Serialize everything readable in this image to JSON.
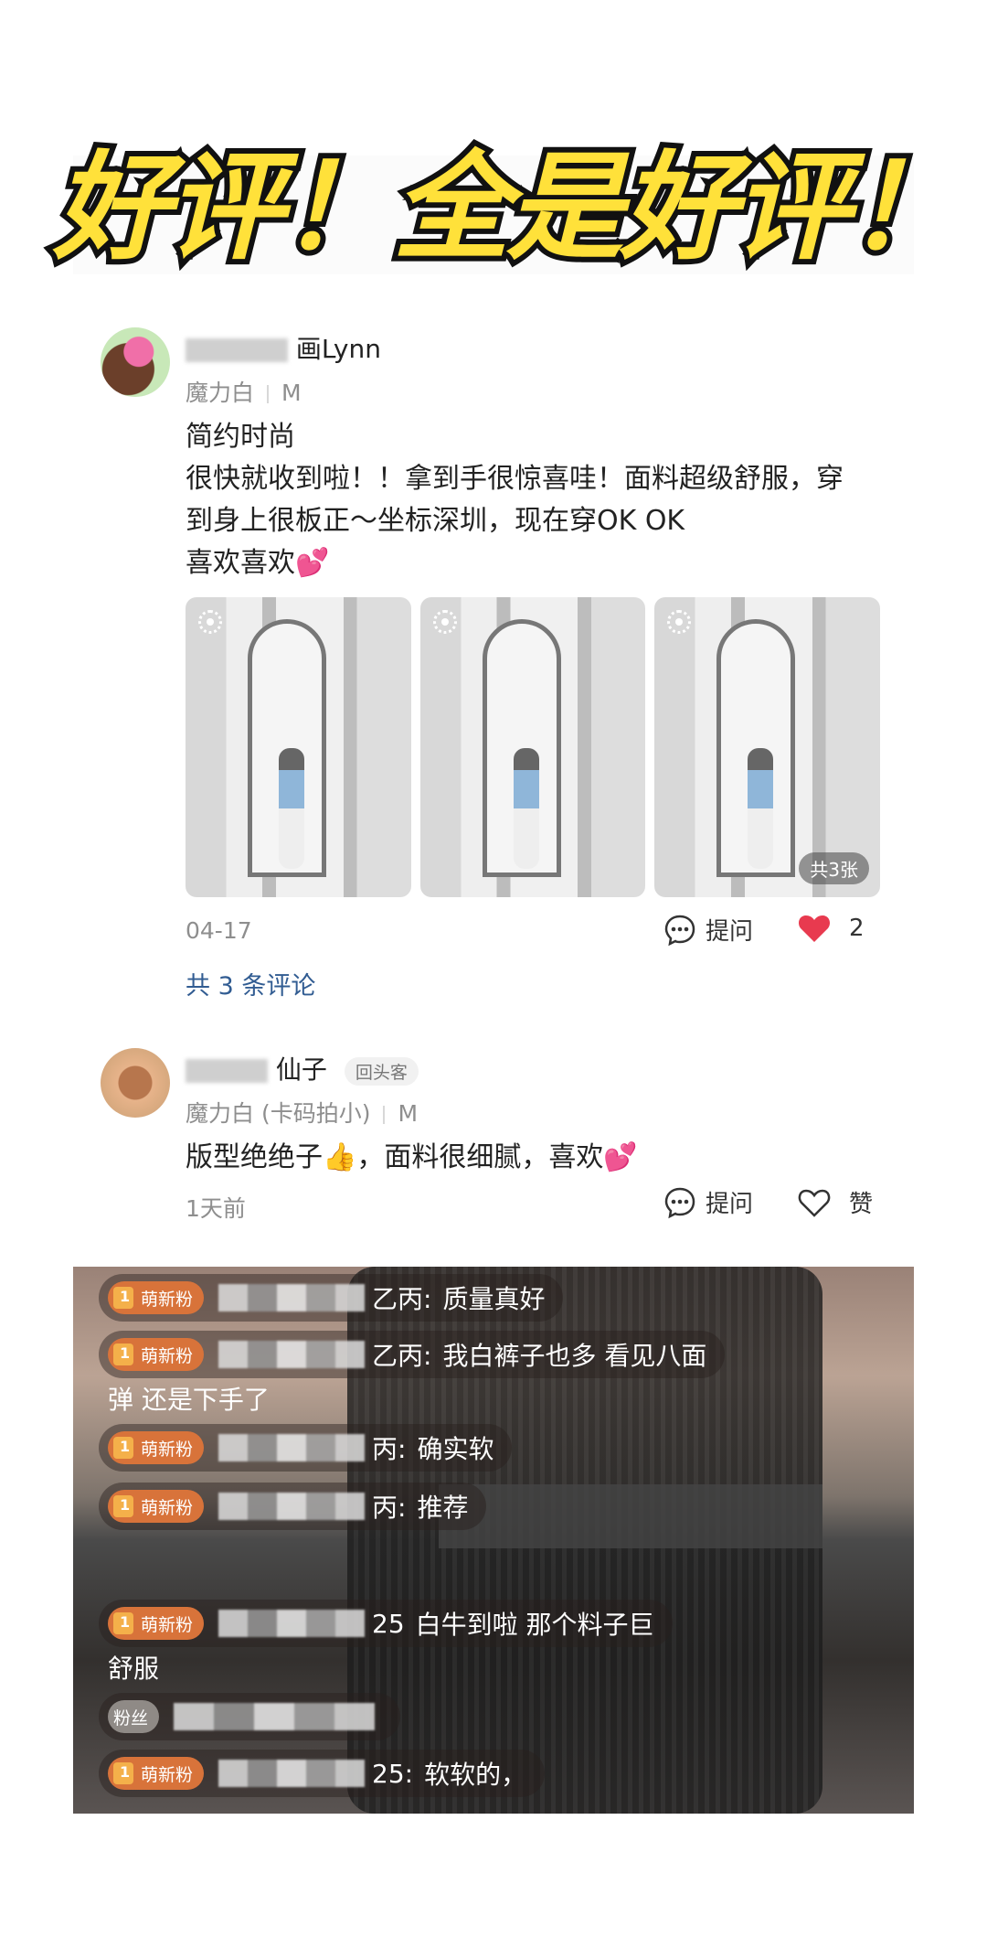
{
  "headline": "好评！全是好评！",
  "review1": {
    "username": "画Lynn",
    "variant": "魔力白",
    "size": "M",
    "title": "简约时尚",
    "content_line1": "很快就收到啦！！拿到手很惊喜哇！面料超级舒服，穿",
    "content_line2": "到身上很板正～坐标深圳，现在穿OK OK",
    "content_line3": "喜欢喜欢💕",
    "photo_count_label": "共3张",
    "date": "04-17",
    "ask_label": "提问",
    "like_count": "2",
    "comment_link": "共 3 条评论"
  },
  "review2": {
    "username": "仙子",
    "tag": "回头客",
    "variant": "魔力白 (卡码拍小)",
    "size": "M",
    "content": "版型绝绝子👍，面料很细腻，喜欢💕",
    "date": "1天前",
    "ask_label": "提问",
    "like_label": "赞"
  },
  "live": {
    "badge_new": "萌新粉",
    "badge_fan": "粉丝",
    "comments": [
      {
        "prefix": "乙丙:",
        "text": "质量真好"
      },
      {
        "prefix": "乙丙:",
        "text": "我白裤子也多 看见八面",
        "wrap": "弹 还是下手了"
      },
      {
        "prefix": "丙:",
        "text": "确实软"
      },
      {
        "prefix": "丙:",
        "text": "推荐"
      },
      {
        "prefix": "25",
        "text": "白牛到啦 那个料子巨",
        "wrap": "舒服"
      },
      {
        "prefix": "",
        "text": ""
      },
      {
        "prefix": "25:",
        "text": "软软的，"
      }
    ]
  },
  "colors": {
    "headline_fill": "#ffe13a",
    "headline_stroke": "#111111",
    "heart_red": "#e83a4f",
    "link_blue": "#315c92",
    "badge_orange": "#d8733a"
  }
}
